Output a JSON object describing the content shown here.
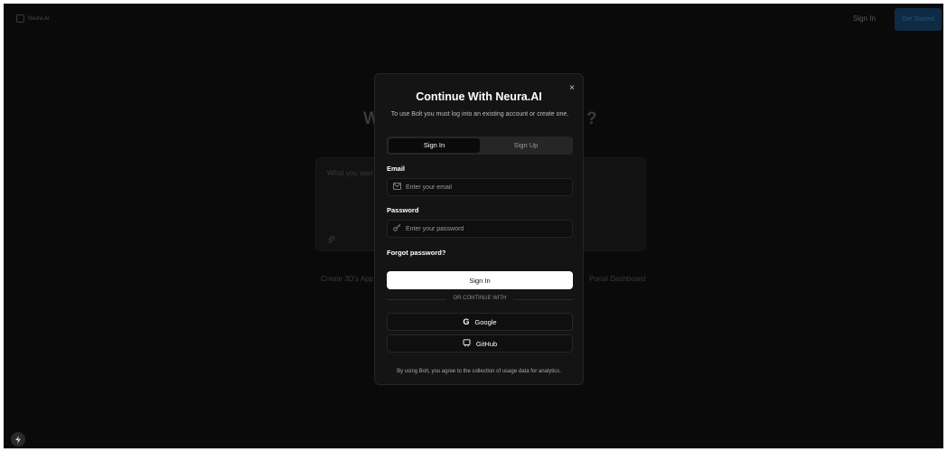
{
  "background": {
    "brand": "Neura.AI",
    "nav": {
      "signin_label": "Sign In",
      "get_started_label": "Get Started"
    },
    "hero": {
      "heading_start": "W",
      "heading_end": "?"
    },
    "prompt": {
      "placeholder": "What you wan"
    },
    "suggestions": {
      "left": "Create 3D's App",
      "right": "Portal Dashboard"
    }
  },
  "modal": {
    "title": "Continue With Neura.AI",
    "subtitle": "To use Bolt you must log into an existing account or create one.",
    "close_icon": "×",
    "tabs": [
      {
        "label": "Sign In",
        "active": true
      },
      {
        "label": "Sign Up",
        "active": false
      }
    ],
    "email": {
      "label": "Email",
      "placeholder": "Enter your email",
      "value": "",
      "icon": "mail-icon"
    },
    "password": {
      "label": "Password",
      "placeholder": "Enter your password",
      "value": "",
      "icon": "key-icon"
    },
    "forgot_label": "Forgot password?",
    "submit_label": "Sign In",
    "divider_text": "OR CONTINUE WITH",
    "social": [
      {
        "label": "Google",
        "icon": "google-icon",
        "glyph": "G"
      },
      {
        "label": "GitHub",
        "icon": "github-icon",
        "glyph": "⊡"
      }
    ],
    "footer_note": "By using Bolt, you agree to the collection of usage data for analytics."
  },
  "colors": {
    "page_bg": "#0a0a0a",
    "modal_bg": "#141414",
    "primary_button": "#ffffff",
    "get_started_bg": "#0f2a44"
  }
}
